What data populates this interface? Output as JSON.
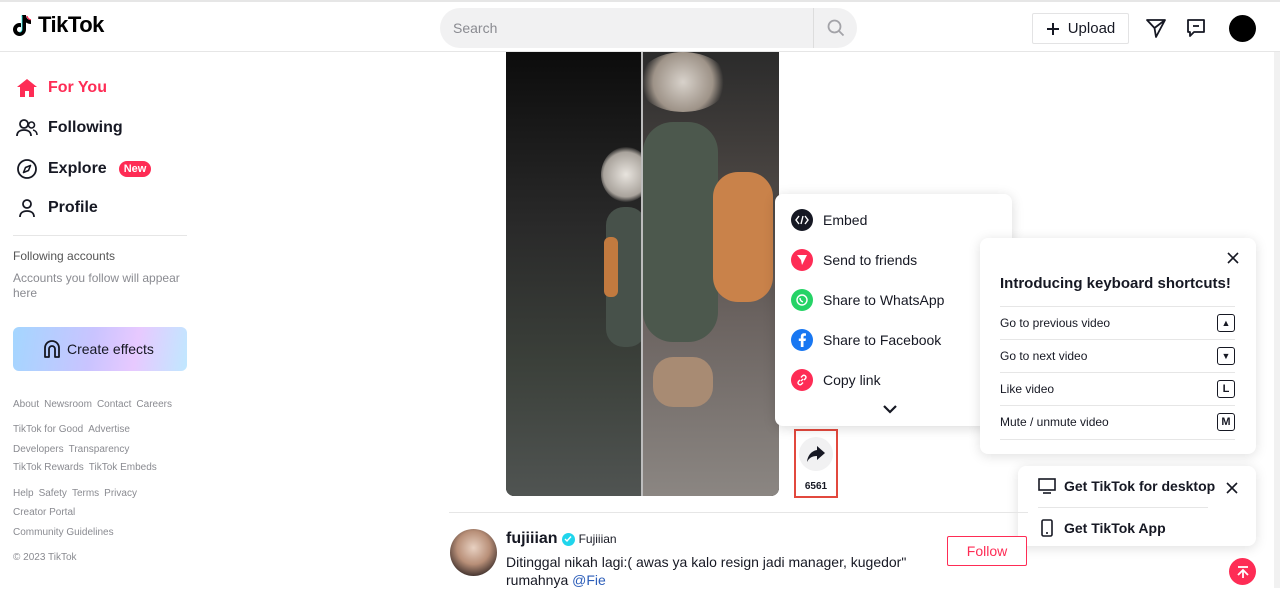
{
  "header": {
    "logo_text": "TikTok",
    "search_placeholder": "Search",
    "upload_label": "Upload"
  },
  "sidebar": {
    "nav": [
      {
        "label": "For You",
        "icon": "home-icon",
        "active": true
      },
      {
        "label": "Following",
        "icon": "users-icon",
        "active": false
      },
      {
        "label": "Explore",
        "icon": "compass-icon",
        "active": false,
        "badge": "New"
      },
      {
        "label": "Profile",
        "icon": "person-icon",
        "active": false
      }
    ],
    "following_title": "Following accounts",
    "following_sub": "Accounts you follow will appear here",
    "create_effects": "Create effects",
    "footer": [
      [
        "About",
        "Newsroom",
        "Contact",
        "Careers"
      ],
      [
        "TikTok for Good",
        "Advertise"
      ],
      [
        "Developers",
        "Transparency"
      ],
      [
        "TikTok Rewards",
        "TikTok Embeds"
      ],
      [
        "Help",
        "Safety",
        "Terms",
        "Privacy"
      ],
      [
        "Creator Portal"
      ],
      [
        "Community Guidelines"
      ],
      [
        "© 2023 TikTok"
      ]
    ]
  },
  "video": {
    "share_count": "6561"
  },
  "share_menu": {
    "items": [
      {
        "label": "Embed",
        "icon": "embed-icon",
        "color": "#161823"
      },
      {
        "label": "Send to friends",
        "icon": "send-icon",
        "color": "#fe2c55"
      },
      {
        "label": "Share to WhatsApp",
        "icon": "whatsapp-icon",
        "color": "#25d366"
      },
      {
        "label": "Share to Facebook",
        "icon": "facebook-icon",
        "color": "#1877f2"
      },
      {
        "label": "Copy link",
        "icon": "link-icon",
        "color": "#fe2c55"
      }
    ]
  },
  "keyboard_shortcuts": {
    "title": "Introducing keyboard shortcuts!",
    "rows": [
      {
        "label": "Go to previous video",
        "key": "▲"
      },
      {
        "label": "Go to next video",
        "key": "▼"
      },
      {
        "label": "Like video",
        "key": "L"
      },
      {
        "label": "Mute / unmute video",
        "key": "M"
      }
    ]
  },
  "get_app": {
    "desktop": "Get TikTok for desktop",
    "app": "Get TikTok App"
  },
  "post": {
    "username": "fujiiian",
    "nickname": "Fujiiian",
    "caption": "Ditinggal nikah lagi:( awas ya kalo resign jadi manager, kugedor\" rumahnya ",
    "mention": "@Fie",
    "follow_label": "Follow"
  },
  "colors": {
    "brand": "#fe2c55",
    "share_highlight": "#e2483d"
  }
}
